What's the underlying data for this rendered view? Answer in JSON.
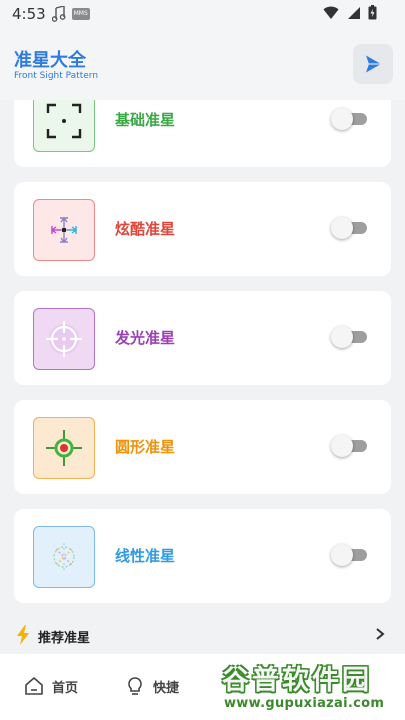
{
  "status_bar": {
    "time": "4:53",
    "mms_badge": "MMS",
    "icons": [
      "music-note-icon",
      "mms-icon",
      "wifi-icon",
      "signal-icon",
      "battery-icon"
    ]
  },
  "header": {
    "title": "准星大全",
    "subtitle": "Front Sight Pattern",
    "action_icon": "play-icon",
    "accent_color": "#2f7be0"
  },
  "crosshairs": [
    {
      "id": "basic",
      "label": "基础准星",
      "color": "#3aa845",
      "enabled": false,
      "icon": "corner-bracket-crosshair-icon"
    },
    {
      "id": "cool",
      "label": "炫酷准星",
      "color": "#e2453a",
      "enabled": false,
      "icon": "arrow-crosshair-icon"
    },
    {
      "id": "glow",
      "label": "发光准星",
      "color": "#9c3fb8",
      "enabled": false,
      "icon": "glow-ring-crosshair-icon"
    },
    {
      "id": "round",
      "label": "圆形准星",
      "color": "#f0920a",
      "enabled": false,
      "icon": "circle-crosshair-icon"
    },
    {
      "id": "linear",
      "label": "线性准星",
      "color": "#2f9be6",
      "enabled": false,
      "icon": "dashed-line-crosshair-icon"
    }
  ],
  "recommend": {
    "label": "推荐准星",
    "icon": "lightning-icon",
    "action_icon": "chevron-right-icon"
  },
  "bottom_nav": [
    {
      "label": "首页",
      "icon": "home-icon"
    },
    {
      "label": "快捷",
      "icon": "lightbulb-icon"
    }
  ],
  "watermark": {
    "title": "谷普软件园",
    "url": "www.gupuxiazai.com"
  }
}
